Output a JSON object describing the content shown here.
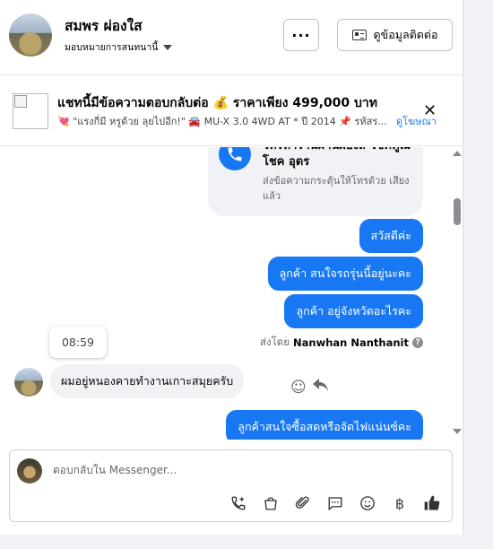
{
  "header": {
    "contact_name": "สมพร ผ่องใส",
    "assignee_label": "มอบหมายการสนทนานี้",
    "more_label": "···",
    "contact_info_label": "ดูข้อมูลติดต่อ"
  },
  "ad": {
    "title": "แชทนี้มีข้อความตอบกลับต่อ 💰 ราคาเพียง 499,000 บาท",
    "subtitle": "💘 \"แรงกี่มี หรูด้วย ลุยไปอีก!\" 🚘 MU-X 3.0 4WD AT * ปี 2014 📌 รหัสร...",
    "link_label": "ดูโฆษณา",
    "close_label": "✕"
  },
  "conversation": {
    "call_card": {
      "title": "โทรหาร้านผ่านผองส โชคคูณโชค อุดร",
      "description": "ส่งข้อความกระตุ้นให้โทรด้วย เสียงแล้ว"
    },
    "outgoing": [
      "สวัสดีค่ะ",
      "ลูกค้า  สนใจรถรุ่นนี้อยู่นะคะ",
      "ลูกค้า   อยู่จังหวัดอะไรคะ"
    ],
    "sent_by_prefix": "ส่งโดย",
    "sent_by_name": "Nanwhan Nanthanit",
    "timestamp": "08:59",
    "incoming": "ผมอยู่หนองคายทำงานเกาะสมุยครับ",
    "last_outgoing": "ลูกค้าสนใจซื้อสดหรือจัดไฟแน่นซ์คะ"
  },
  "composer": {
    "placeholder": "ตอบกลับใน Messenger...",
    "tools": [
      "call-icon",
      "shop-bag-icon",
      "attachment-icon",
      "saved-reply-icon",
      "emoji-icon",
      "baht-icon",
      "like-icon"
    ]
  },
  "colors": {
    "accent": "#1877f2",
    "bubble_in": "#f0f2f5"
  }
}
